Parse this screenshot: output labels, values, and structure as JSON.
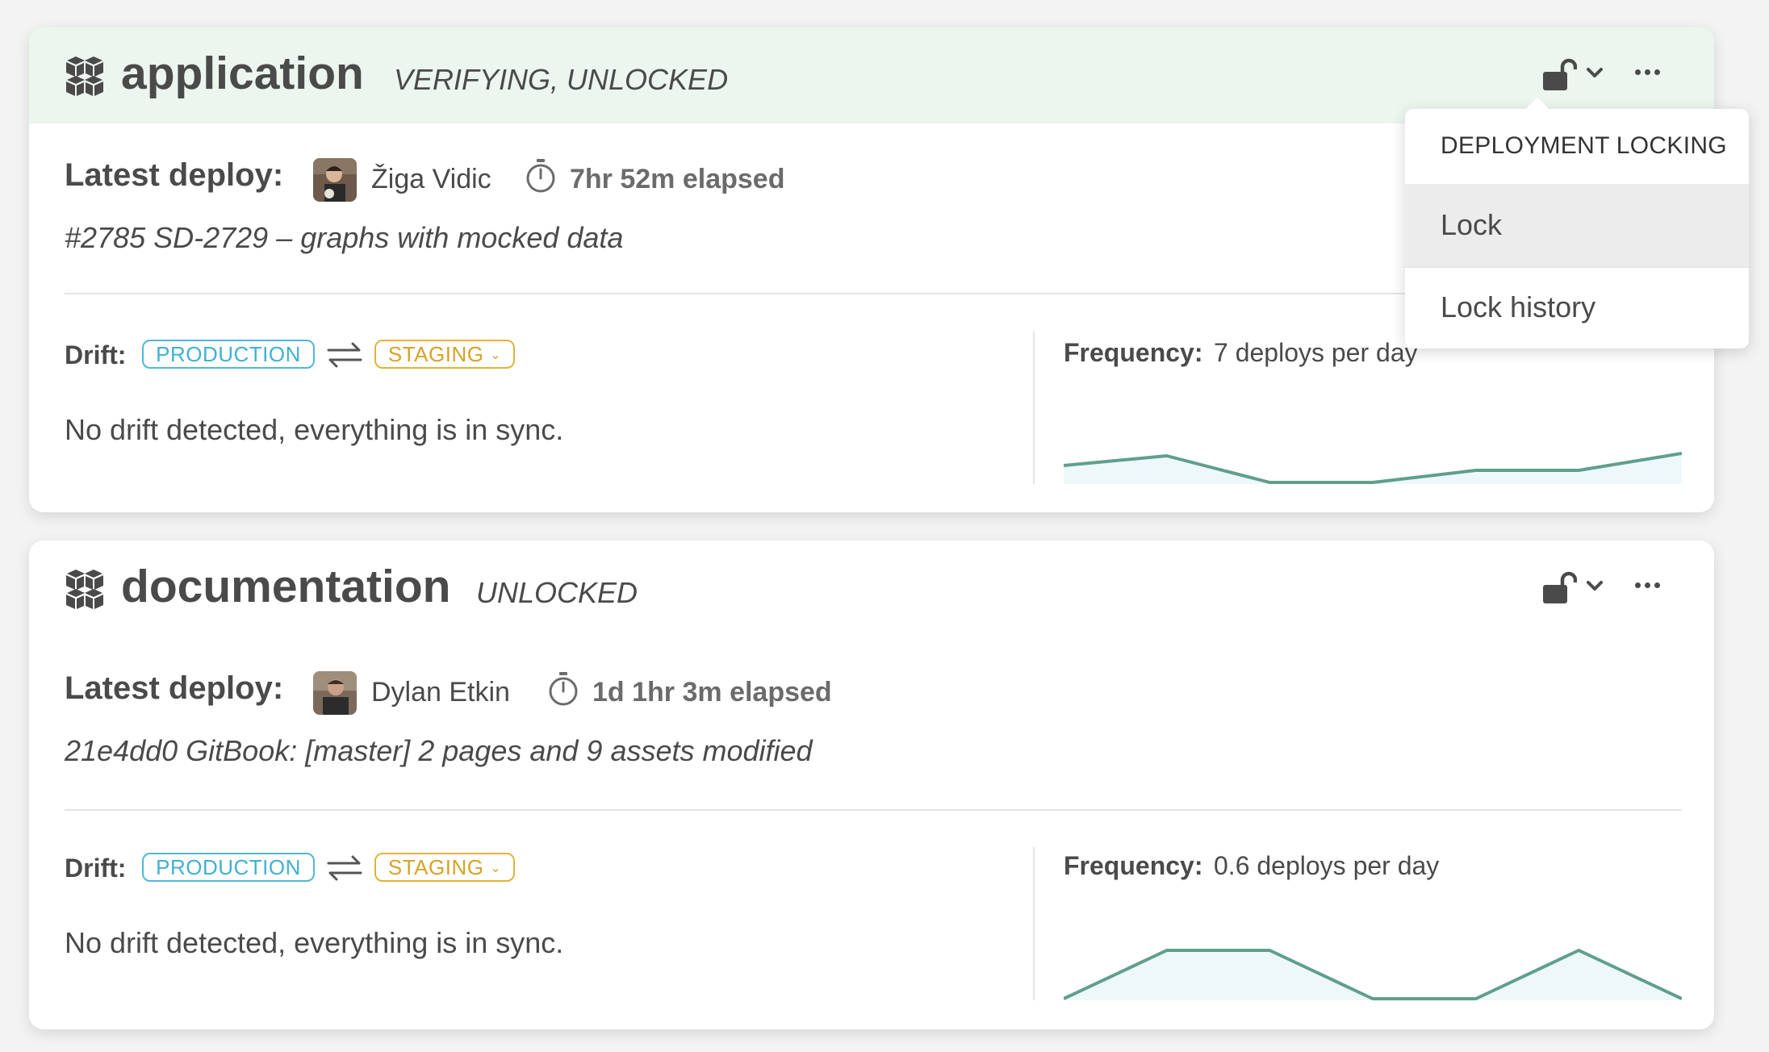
{
  "projects": [
    {
      "name": "application",
      "status": "VERIFYING, UNLOCKED",
      "latest_label": "Latest deploy:",
      "author": "Žiga Vidic",
      "elapsed": "7hr 52m elapsed",
      "commit": "#2785 SD-2729 – graphs with mocked data",
      "drift_label": "Drift:",
      "env_from": "PRODUCTION",
      "env_to": "STAGING",
      "drift_message": "No drift detected, everything is in sync.",
      "frequency_label": "Frequency:",
      "frequency_value": "7 deploys per day",
      "sparkline": [
        0.35,
        0.55,
        0.0,
        0.0,
        0.25,
        0.25,
        0.6
      ]
    },
    {
      "name": "documentation",
      "status": "UNLOCKED",
      "latest_label": "Latest deploy:",
      "author": "Dylan Etkin",
      "elapsed": "1d 1hr 3m elapsed",
      "commit": "21e4dd0 GitBook: [master] 2 pages and 9 assets modified",
      "drift_label": "Drift:",
      "env_from": "PRODUCTION",
      "env_to": "STAGING",
      "drift_message": "No drift detected, everything is in sync.",
      "frequency_label": "Frequency:",
      "frequency_value": "0.6 deploys per day",
      "sparkline": [
        0.0,
        1.0,
        1.0,
        0.0,
        0.0,
        1.0,
        0.0
      ]
    }
  ],
  "dropdown": {
    "heading": "DEPLOYMENT LOCKING",
    "items": [
      "Lock",
      "Lock history"
    ],
    "highlighted": "Lock"
  },
  "colors": {
    "header_verifying": "#ecf6ee",
    "production": "#3fb1d3",
    "staging": "#d7a325",
    "sparkline_stroke": "#5f9f8c",
    "sparkline_fill": "#eef8fa"
  },
  "icons": {
    "package": "package-icon",
    "lock": "unlocked-padlock-icon",
    "timer": "stopwatch-icon",
    "swap": "swap-arrows-icon",
    "more": "ellipsis-icon"
  }
}
